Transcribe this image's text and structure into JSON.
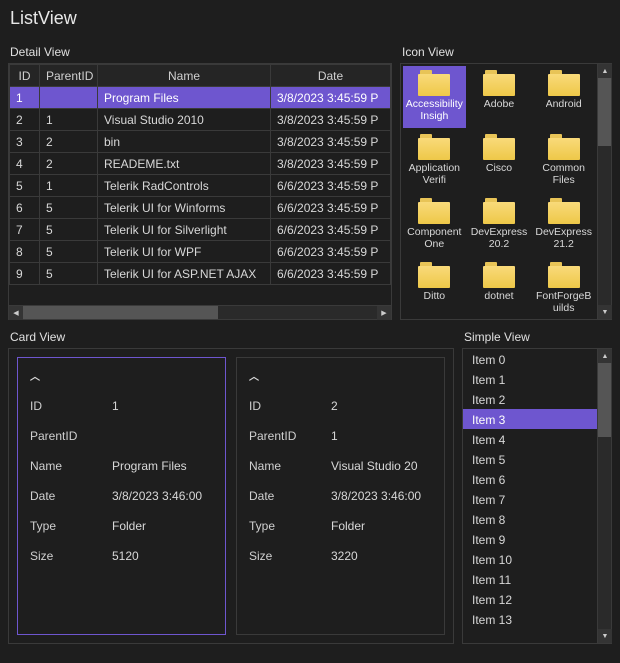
{
  "window": {
    "title": "ListView"
  },
  "panels": {
    "detail": "Detail View",
    "icon": "Icon View",
    "card": "Card View",
    "simple": "Simple View"
  },
  "detailView": {
    "columns": [
      "ID",
      "ParentID",
      "Name",
      "Date"
    ],
    "selectedIndex": 0,
    "rows": [
      {
        "ID": "1",
        "ParentID": "",
        "Name": "Program Files",
        "Date": "3/8/2023 3:45:59 P"
      },
      {
        "ID": "2",
        "ParentID": "1",
        "Name": "Visual Studio 2010",
        "Date": "3/8/2023 3:45:59 P"
      },
      {
        "ID": "3",
        "ParentID": "2",
        "Name": "bin",
        "Date": "3/8/2023 3:45:59 P"
      },
      {
        "ID": "4",
        "ParentID": "2",
        "Name": "READEME.txt",
        "Date": "3/8/2023 3:45:59 P"
      },
      {
        "ID": "5",
        "ParentID": "1",
        "Name": "Telerik RadControls",
        "Date": "6/6/2023 3:45:59 P"
      },
      {
        "ID": "6",
        "ParentID": "5",
        "Name": "Telerik UI for Winforms",
        "Date": "6/6/2023 3:45:59 P"
      },
      {
        "ID": "7",
        "ParentID": "5",
        "Name": "Telerik UI for Silverlight",
        "Date": "6/6/2023 3:45:59 P"
      },
      {
        "ID": "8",
        "ParentID": "5",
        "Name": "Telerik UI for WPF",
        "Date": "6/6/2023 3:45:59 P"
      },
      {
        "ID": "9",
        "ParentID": "5",
        "Name": "Telerik UI for ASP.NET AJAX",
        "Date": "6/6/2023 3:45:59 P"
      }
    ]
  },
  "iconView": {
    "selectedIndex": 0,
    "items": [
      "AccessibilityInsigh",
      "Adobe",
      "Android",
      "Application Verifi",
      "Cisco",
      "Common Files",
      "ComponentOne",
      "DevExpress 20.2",
      "DevExpress 21.2",
      "Ditto",
      "dotnet",
      "FontForgeBuilds"
    ]
  },
  "cardView": {
    "labels": {
      "ID": "ID",
      "ParentID": "ParentID",
      "Name": "Name",
      "Date": "Date",
      "Type": "Type",
      "Size": "Size"
    },
    "selectedIndex": 0,
    "cards": [
      {
        "ID": "1",
        "ParentID": "",
        "Name": "Program Files",
        "Date": "3/8/2023 3:46:00",
        "Type": "Folder",
        "Size": "5120"
      },
      {
        "ID": "2",
        "ParentID": "1",
        "Name": "Visual Studio 20",
        "Date": "3/8/2023 3:46:00",
        "Type": "Folder",
        "Size": "3220"
      }
    ]
  },
  "simpleView": {
    "selectedIndex": 3,
    "items": [
      "Item 0",
      "Item 1",
      "Item 2",
      "Item 3",
      "Item 4",
      "Item 5",
      "Item 6",
      "Item 7",
      "Item 8",
      "Item 9",
      "Item 10",
      "Item 11",
      "Item 12",
      "Item 13"
    ]
  }
}
